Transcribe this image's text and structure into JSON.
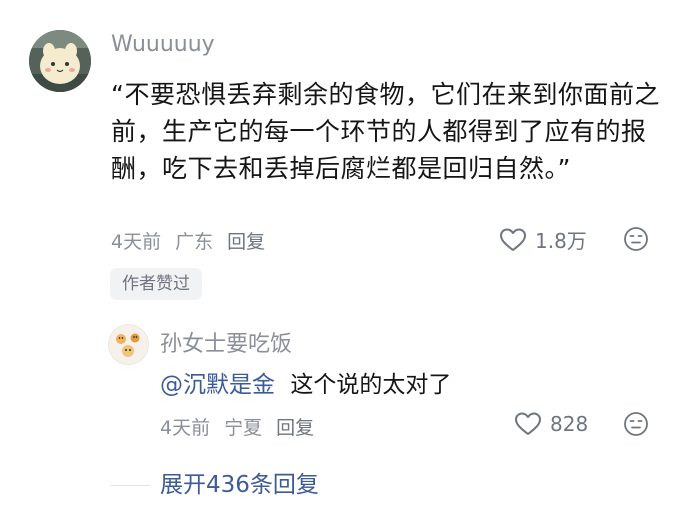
{
  "comment": {
    "username": "Wuuuuuy",
    "text": "“不要恐惧丢弃剩余的食物，它们在来到你面前之前，生产它的每一个环节的人都得到了应有的报酬，吃下去和丢掉后腐烂都是回归自然。”",
    "time": "4天前",
    "location": "广东",
    "reply_label": "回复",
    "like_count": "1.8万",
    "author_badge": "作者赞过"
  },
  "reply": {
    "username": "孙女士要吃饭",
    "mention": "@沉默是金",
    "text": "这个说的太对了",
    "time": "4天前",
    "location": "宁夏",
    "reply_label": "回复",
    "like_count": "828"
  },
  "expand_label": "展开436条回复",
  "icons": {
    "like": "heart-outline-icon",
    "dislike": "dislike-face-icon"
  },
  "colors": {
    "link": "#3d5a99",
    "meta": "#8a8f99",
    "text": "#151515"
  }
}
